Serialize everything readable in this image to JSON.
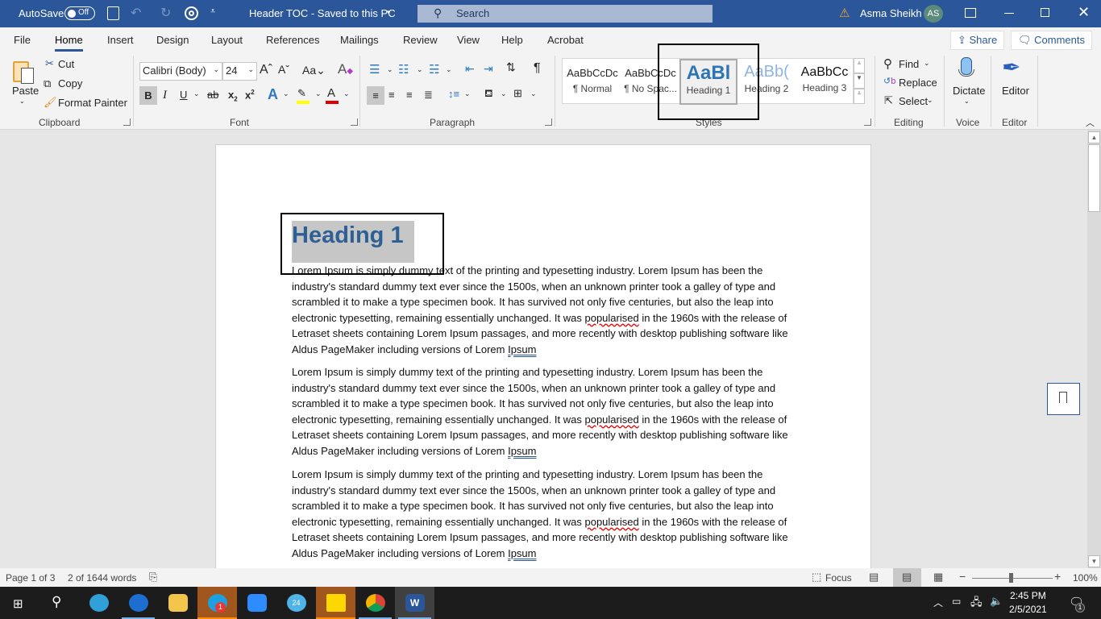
{
  "titlebar": {
    "autosave_label": "AutoSave",
    "autosave_state": "Off",
    "doc_title": "Header TOC  -  Saved to this PC",
    "search_placeholder": "Search",
    "user_name": "Asma Sheikh",
    "user_initials": "AS"
  },
  "tabs": [
    {
      "label": "File"
    },
    {
      "label": "Home",
      "active": true
    },
    {
      "label": "Insert"
    },
    {
      "label": "Design"
    },
    {
      "label": "Layout"
    },
    {
      "label": "References"
    },
    {
      "label": "Mailings"
    },
    {
      "label": "Review"
    },
    {
      "label": "View"
    },
    {
      "label": "Help"
    },
    {
      "label": "Acrobat"
    }
  ],
  "top_buttons": {
    "share": "Share",
    "comments": "Comments"
  },
  "ribbon": {
    "clipboard": {
      "paste": "Paste",
      "cut": "Cut",
      "copy": "Copy",
      "format_painter": "Format Painter",
      "label": "Clipboard"
    },
    "font": {
      "family": "Calibri (Body)",
      "size": "24",
      "label": "Font",
      "highlight_color": "#ffff00",
      "font_color": "#e00000"
    },
    "paragraph": {
      "label": "Paragraph"
    },
    "styles": {
      "label": "Styles",
      "items": [
        {
          "preview": "AaBbCcDc",
          "name": "¶ Normal"
        },
        {
          "preview": "AaBbCcDc",
          "name": "¶ No Spac..."
        },
        {
          "preview": "AaBl",
          "name": "Heading 1",
          "selected": true
        },
        {
          "preview": "AaBb(",
          "name": "Heading 2"
        },
        {
          "preview": "AaBbCc",
          "name": "Heading 3"
        }
      ]
    },
    "editing": {
      "find": "Find",
      "replace": "Replace",
      "select": "Select",
      "label": "Editing"
    },
    "voice": {
      "dictate": "Dictate",
      "label": "Voice"
    },
    "editor": {
      "editor": "Editor",
      "label": "Editor"
    }
  },
  "document": {
    "heading": "Heading 1",
    "paragraphs": [
      {
        "before": "Lorem Ipsum is simply dummy text of the printing and typesetting industry. Lorem Ipsum has been the industry's standard dummy text ever since the 1500s, when an unknown printer took a galley of type and scrambled it to make a type specimen book. It has survived not only five centuries, but also the leap into electronic typesetting, remaining essentially unchanged. It was ",
        "misspelled": "popularised",
        "middle": " in the 1960s with the release of Letraset sheets containing Lorem Ipsum passages, and more recently with desktop publishing software like Aldus PageMaker including versions of Lorem ",
        "flagged": "Ipsum"
      },
      {
        "before": "Lorem Ipsum is simply dummy text of the printing and typesetting industry. Lorem Ipsum has been the industry's standard dummy text ever since the 1500s, when an unknown printer took a galley of type and scrambled it to make a type specimen book. It has survived not only five centuries, but also the leap into electronic typesetting, remaining essentially unchanged. It was ",
        "misspelled": "popularised",
        "middle": " in the 1960s with the release of Letraset sheets containing Lorem Ipsum passages, and more recently with desktop publishing software like Aldus PageMaker including versions of Lorem ",
        "flagged": "Ipsum"
      },
      {
        "before": "Lorem Ipsum is simply dummy text of the printing and typesetting industry. Lorem Ipsum has been the industry's standard dummy text ever since the 1500s, when an unknown printer took a galley of type and scrambled it to make a type specimen book. It has survived not only five centuries, but also the leap into electronic typesetting, remaining essentially unchanged. It was ",
        "misspelled": "popularised",
        "middle": " in the 1960s with the release of Letraset sheets containing Lorem Ipsum passages, and more recently with desktop publishing software like Aldus PageMaker including versions of Lorem ",
        "flagged": "Ipsum"
      }
    ]
  },
  "statusbar": {
    "page": "Page 1 of 3",
    "words": "2 of 1644 words",
    "focus": "Focus",
    "zoom_minus": "−",
    "zoom_plus": "+",
    "zoom_level": "100%"
  },
  "taskbar": {
    "time": "2:45 PM",
    "date": "2/5/2021",
    "skype_badge": "1",
    "notification_badge": "1",
    "calendar_badge": "24"
  }
}
